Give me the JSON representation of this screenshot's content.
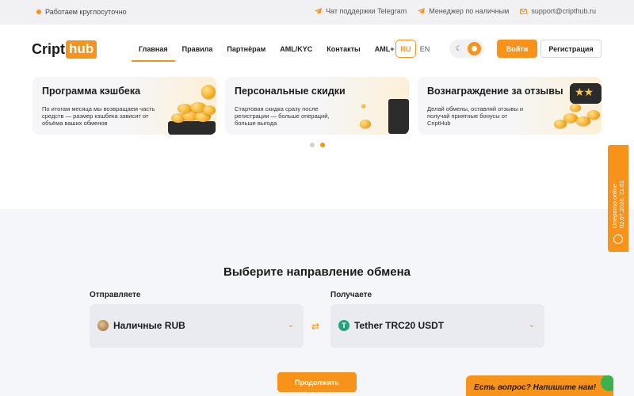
{
  "topbar": {
    "status": "Работаем круглосуточно",
    "telegram_support": "Чат поддержки Telegram",
    "cash_manager": "Менеджер по наличным",
    "email": "support@cripthub.ru"
  },
  "header": {
    "logo_part1": "Cript",
    "logo_part2": "hub",
    "nav": [
      {
        "label": "Главная",
        "active": true
      },
      {
        "label": "Правила"
      },
      {
        "label": "Партнёрам"
      },
      {
        "label": "AML/KYC"
      },
      {
        "label": "Контакты"
      },
      {
        "label": "AML+"
      }
    ],
    "lang_ru": "RU",
    "lang_en": "EN",
    "login": "Войти",
    "register": "Регистрация"
  },
  "promos": [
    {
      "title": "Программа кэшбека",
      "desc": "По итогам месяца мы возвращаем часть средств — размер кэшбека зависит от объёма ваших обменов"
    },
    {
      "title": "Персональные скидки",
      "desc": "Стартовая скидка сразу после регистрации — больше операций, больше выгода"
    },
    {
      "title": "Вознаграждение за отзывы",
      "desc": "Делай обмены, оставляй отзывы и получай приятные бонусы от CriptHub"
    }
  ],
  "exchange": {
    "title": "Выберите направление обмена",
    "send_label": "Отправляете",
    "recv_label": "Получаете",
    "send_currency": "Наличные RUB",
    "recv_currency": "Tether TRC20 USDT",
    "continue": "Продолжить"
  },
  "operator": {
    "status": "Оператор online",
    "datetime": "02.07.2026, 21:02"
  },
  "chat": {
    "prompt": "Есть вопрос? Напишите нам!"
  },
  "colors": {
    "accent": "#f7931a",
    "usdt": "#26a17b"
  }
}
